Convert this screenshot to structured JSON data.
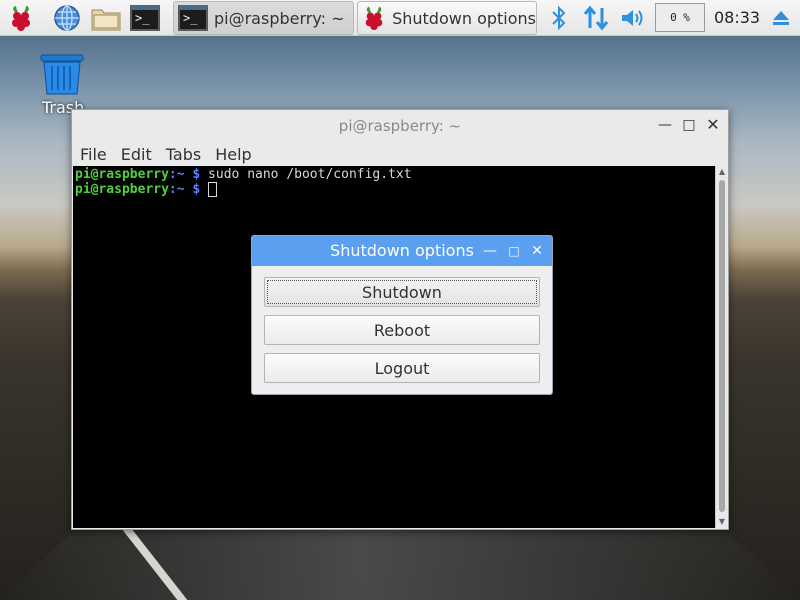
{
  "panel": {
    "tasks": [
      {
        "label": "pi@raspberry: ~"
      },
      {
        "label": "Shutdown options"
      }
    ],
    "cpu": "0 %",
    "clock": "08:33"
  },
  "desktop": {
    "trash_label": "Trash"
  },
  "terminal": {
    "title": "pi@raspberry: ~",
    "menu": [
      "File",
      "Edit",
      "Tabs",
      "Help"
    ],
    "lines": [
      {
        "user": "pi@raspberry",
        "sep": ":~ $",
        "cmd": " sudo nano /boot/config.txt"
      },
      {
        "user": "pi@raspberry",
        "sep": ":~ $",
        "cmd": " "
      }
    ]
  },
  "dialog": {
    "title": "Shutdown options",
    "buttons": [
      "Shutdown",
      "Reboot",
      "Logout"
    ]
  },
  "colors": {
    "dialog_title": "#5a9ff0",
    "prompt_user": "#4fd13c",
    "prompt_path": "#5b7fff"
  }
}
